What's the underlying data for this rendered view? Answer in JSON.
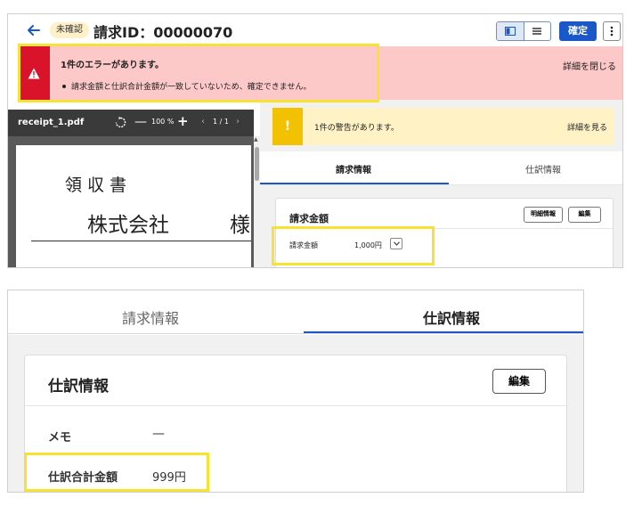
{
  "header": {
    "status_badge": "未確認",
    "title": "請求ID：00000070",
    "confirm_label": "確定",
    "back_icon": "arrow-left-icon",
    "more_icon": "vertical-dots-icon"
  },
  "error_banner": {
    "title": "1件のエラーがあります。",
    "item": "請求金額と仕訳合計金額が一致していないため、確定できません。",
    "close_label": "詳細を閉じる",
    "color": "#fdc8c8",
    "icon_color": "#d9142a"
  },
  "pdf_viewer": {
    "filename": "receipt_1.pdf",
    "zoom_out": "—",
    "zoom_level": "100 %",
    "zoom_in": "+",
    "prev_page": "‹",
    "page_indicator": "1 / 1",
    "next_page": "›",
    "document": {
      "title": "領収書",
      "company": "株式会社",
      "suffix": "様"
    }
  },
  "warning_banner": {
    "icon": "!",
    "title": "1件の警告があります。",
    "details_label": "詳細を見る",
    "color": "#fff3c6",
    "icon_color": "#f2c202"
  },
  "tabs": [
    {
      "label": "請求情報"
    },
    {
      "label": "仕訳情報"
    }
  ],
  "billing_card": {
    "title": "請求金額",
    "detail_button": "明細情報",
    "edit_button": "編集",
    "amount_label": "請求金額",
    "amount_value": "1,000円"
  },
  "journal_card": {
    "title": "仕訳情報",
    "edit_button": "編集",
    "memo_label": "メモ",
    "memo_value": "—",
    "total_label": "仕訳合計金額",
    "total_value": "999円"
  },
  "colors": {
    "accent": "#1a57c8",
    "highlight": "#f8e231"
  }
}
